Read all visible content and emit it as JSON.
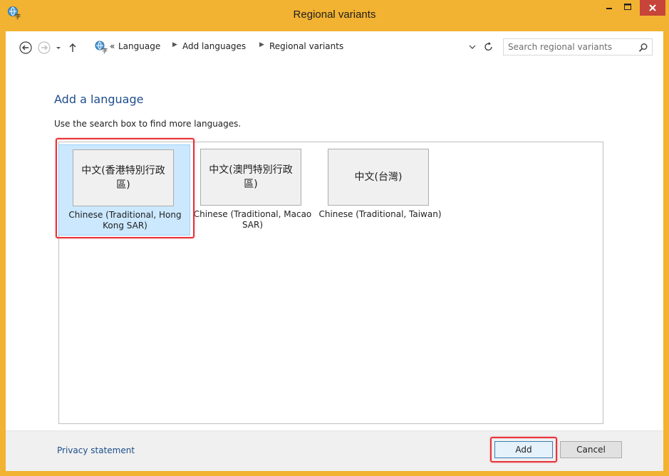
{
  "window": {
    "title": "Regional variants",
    "accent": "#f2b232",
    "close_color": "#c7443a"
  },
  "addressbar": {
    "overflow": "«",
    "crumbs": [
      "Language",
      "Add languages",
      "Regional variants"
    ],
    "search_placeholder": "Search regional variants"
  },
  "main": {
    "title": "Add a language",
    "instruction": "Use the search box to find more languages.",
    "tiles": [
      {
        "native": "中文(香港特別行政區)",
        "label": "Chinese (Traditional, Hong Kong SAR)",
        "selected": true
      },
      {
        "native": "中文(澳門特別行政區)",
        "label": "Chinese (Traditional, Macao SAR)",
        "selected": false
      },
      {
        "native": "中文(台灣)",
        "label": "Chinese (Traditional, Taiwan)",
        "selected": false
      }
    ]
  },
  "footer": {
    "privacy": "Privacy statement",
    "add_label": "Add",
    "cancel_label": "Cancel"
  },
  "icons": [
    "app-language-icon",
    "minimize-icon",
    "maximize-icon",
    "close-icon",
    "back-arrow-icon",
    "forward-arrow-icon",
    "recent-dropdown-icon",
    "up-arrow-icon",
    "dropdown-chevron-icon",
    "refresh-icon",
    "search-icon"
  ]
}
